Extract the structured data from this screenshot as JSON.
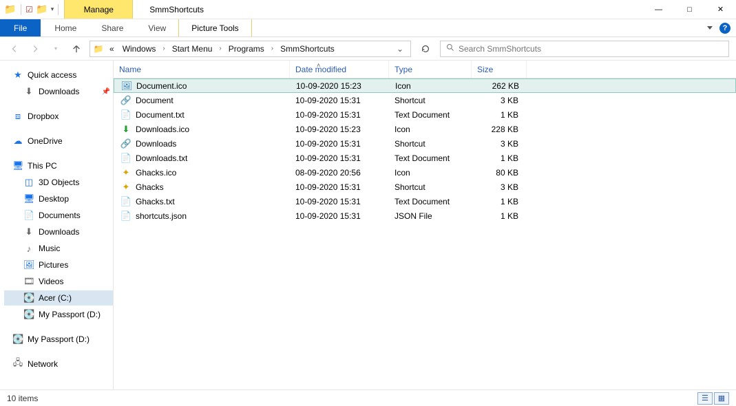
{
  "window": {
    "title": "SmmShortcuts",
    "contextual_tab": "Manage",
    "contextual_sub": "Picture Tools"
  },
  "ribbon": {
    "file": "File",
    "tabs": [
      "Home",
      "Share",
      "View"
    ]
  },
  "breadcrumb": {
    "prefix": "«",
    "parts": [
      "Windows",
      "Start Menu",
      "Programs",
      "SmmShortcuts"
    ]
  },
  "search": {
    "placeholder": "Search SmmShortcuts"
  },
  "sidebar": {
    "quick_access": "Quick access",
    "downloads_pinned": "Downloads",
    "dropbox": "Dropbox",
    "onedrive": "OneDrive",
    "this_pc": "This PC",
    "pc_items": [
      "3D Objects",
      "Desktop",
      "Documents",
      "Downloads",
      "Music",
      "Pictures",
      "Videos",
      "Acer (C:)",
      "My Passport (D:)"
    ],
    "my_passport_root": "My Passport (D:)",
    "network": "Network"
  },
  "columns": {
    "name": "Name",
    "date": "Date modified",
    "type": "Type",
    "size": "Size"
  },
  "files": [
    {
      "icon": "image-icon",
      "name": "Document.ico",
      "date": "10-09-2020 15:23",
      "type": "Icon",
      "size": "262 KB",
      "selected": true
    },
    {
      "icon": "shortcut-icon",
      "name": "Document",
      "date": "10-09-2020 15:31",
      "type": "Shortcut",
      "size": "3 KB"
    },
    {
      "icon": "text-icon",
      "name": "Document.txt",
      "date": "10-09-2020 15:31",
      "type": "Text Document",
      "size": "1 KB"
    },
    {
      "icon": "dl-icon",
      "name": "Downloads.ico",
      "date": "10-09-2020 15:23",
      "type": "Icon",
      "size": "228 KB"
    },
    {
      "icon": "shortcut-icon",
      "name": "Downloads",
      "date": "10-09-2020 15:31",
      "type": "Shortcut",
      "size": "3 KB"
    },
    {
      "icon": "text-icon",
      "name": "Downloads.txt",
      "date": "10-09-2020 15:31",
      "type": "Text Document",
      "size": "1 KB"
    },
    {
      "icon": "gh-icon",
      "name": "Ghacks.ico",
      "date": "08-09-2020 20:56",
      "type": "Icon",
      "size": "80 KB"
    },
    {
      "icon": "gh-icon",
      "name": "Ghacks",
      "date": "10-09-2020 15:31",
      "type": "Shortcut",
      "size": "3 KB"
    },
    {
      "icon": "text-icon",
      "name": "Ghacks.txt",
      "date": "10-09-2020 15:31",
      "type": "Text Document",
      "size": "1 KB"
    },
    {
      "icon": "text-icon",
      "name": "shortcuts.json",
      "date": "10-09-2020 15:31",
      "type": "JSON File",
      "size": "1 KB"
    }
  ],
  "status": {
    "text": "10 items"
  }
}
